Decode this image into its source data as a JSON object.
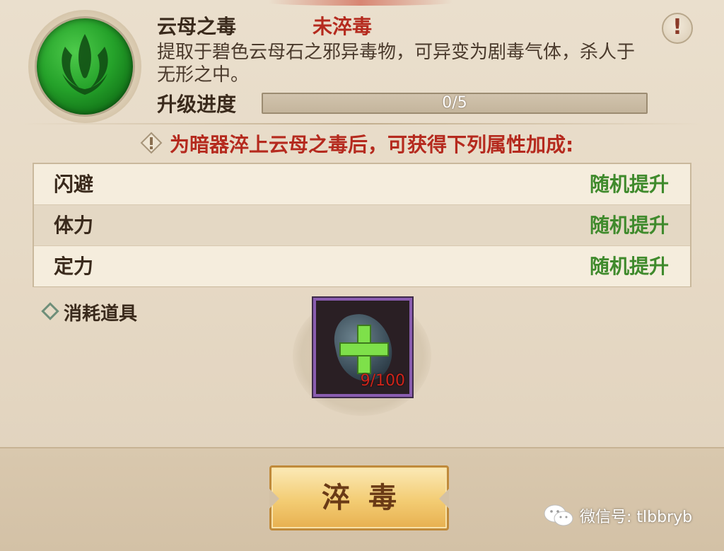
{
  "skill": {
    "title": "云母之毒",
    "status": "未淬毒",
    "description": "提取于碧色云母石之邪异毒物，可异变为剧毒气体，杀人于无形之中。",
    "icon": "poison-orb-icon"
  },
  "info_button": {
    "label": "!"
  },
  "progress": {
    "label": "升级进度",
    "text": "0/5",
    "value": 0,
    "max": 5
  },
  "notice": {
    "text": "为暗器淬上云母之毒后，可获得下列属性加成:",
    "icon": "warning-icon"
  },
  "attributes": [
    {
      "name": "闪避",
      "value": "随机提升"
    },
    {
      "name": "体力",
      "value": "随机提升"
    },
    {
      "name": "定力",
      "value": "随机提升"
    }
  ],
  "consume": {
    "label": "消耗道具",
    "item": {
      "icon": "mica-stone-icon",
      "count": "9/100"
    }
  },
  "action_button": {
    "label": "淬毒"
  },
  "watermark": {
    "text": "微信号: tlbbryb",
    "icon": "wechat-icon"
  },
  "colors": {
    "title": "#3a2a1c",
    "status_red": "#b52a1e",
    "attr_green": "#3f8a2c",
    "button_gold": "#f3cc73"
  }
}
